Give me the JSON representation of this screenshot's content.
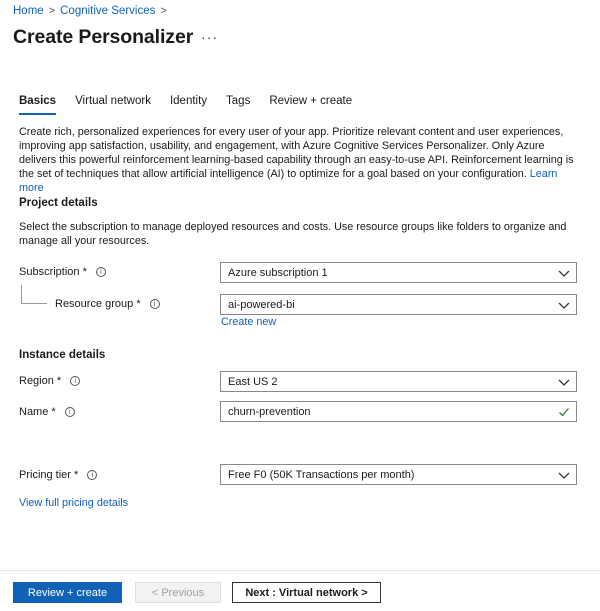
{
  "breadcrumb": {
    "home": "Home",
    "separator": ">",
    "service": "Cognitive Services",
    "trailing": ">"
  },
  "header": {
    "title": "Create Personalizer",
    "more": "···"
  },
  "tabs": [
    {
      "label": "Basics",
      "active": true
    },
    {
      "label": "Virtual network",
      "active": false
    },
    {
      "label": "Identity",
      "active": false
    },
    {
      "label": "Tags",
      "active": false
    },
    {
      "label": "Review + create",
      "active": false
    }
  ],
  "intro": {
    "text": "Create rich, personalized experiences for every user of your app. Prioritize relevant content and user experiences, improving app satisfaction, usability, and engagement, with Azure Cognitive Services Personalizer. Only Azure delivers this powerful reinforcement learning-based capability through an easy-to-use API. Reinforcement learning is the set of techniques that allow artificial intelligence (AI) to optimize for a goal based on your configuration.",
    "link": "Learn more"
  },
  "project": {
    "heading": "Project details",
    "description": "Select the subscription to manage deployed resources and costs. Use resource groups like folders to organize and manage all your resources.",
    "subscription_label": "Subscription *",
    "subscription_value": "Azure subscription 1",
    "resource_group_label": "Resource group *",
    "resource_group_value": "ai-powered-bi",
    "create_new": "Create new"
  },
  "instance": {
    "heading": "Instance details",
    "region_label": "Region *",
    "region_value": "East US 2",
    "name_label": "Name *",
    "name_value": "churn-prevention",
    "pricing_label": "Pricing tier *",
    "pricing_value": "Free F0 (50K Transactions per month)",
    "pricing_link": "View full pricing details"
  },
  "footer": {
    "review_create": "Review + create",
    "previous": "< Previous",
    "next": "Next : Virtual network >"
  },
  "colors": {
    "accent": "#0f62b5",
    "success_check": "#2e7d32"
  },
  "icons": {
    "info": "info-icon",
    "chevron": "chevron-down-icon",
    "valid": "checkmark-icon"
  }
}
